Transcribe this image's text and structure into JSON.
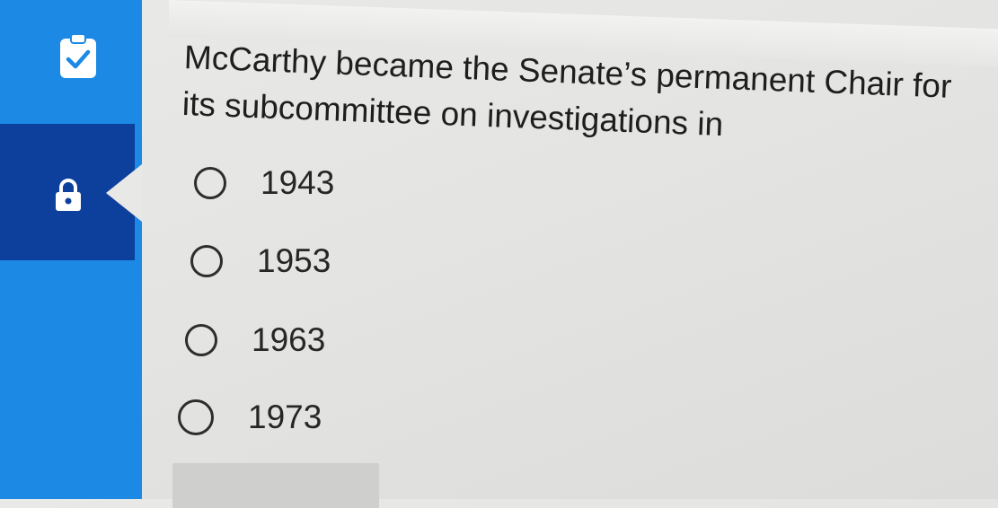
{
  "sidebar": {
    "items": [
      {
        "id": "checklist",
        "icon": "clipboard-check-icon",
        "active": false
      },
      {
        "id": "locked",
        "icon": "lock-icon",
        "active": true
      }
    ],
    "colors": {
      "sidebar": "#1c8ae4",
      "active": "#0d3f9c"
    }
  },
  "question": {
    "text": "McCarthy became the Senate’s permanent Chair for its subcommittee on investigations in",
    "options": [
      "1943",
      "1953",
      "1963",
      "1973"
    ]
  }
}
